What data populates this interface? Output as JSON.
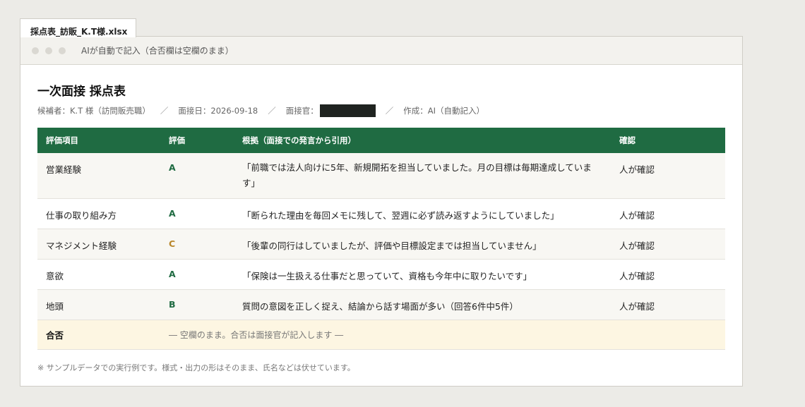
{
  "file_tab": {
    "label": "採点表_訪販_K.T様.xlsx"
  },
  "window": {
    "status_text": "AIが自動で記入（合否欄は空欄のまま）"
  },
  "document": {
    "title": "一次面接 採点表",
    "meta": {
      "candidate": "候補者：K.T 様（訪問販売職）",
      "date": "面接日：2026-09-18",
      "interviewer_label": "面接官：",
      "author": "作成：AI（自動記入）",
      "separator": "／"
    }
  },
  "table": {
    "headers": [
      "評価項目",
      "評価",
      "根拠（面接での発言から引用）",
      "確認"
    ],
    "rows": [
      {
        "item": "営業経験",
        "grade": "A",
        "evidence": "「前職では法人向けに5年、新規開拓を担当していました。月の目標は毎期達成していま す」",
        "confirm": "人が確認"
      },
      {
        "item": "仕事の取り組み方",
        "grade": "A",
        "evidence": "「断られた理由を毎回メモに残して、翌週に必ず読み返すようにしていました」",
        "confirm": "人が確認"
      },
      {
        "item": "マネジメント経験",
        "grade": "C",
        "evidence": "「後輩の同行はしていましたが、評価や目標設定までは担当していません」",
        "confirm": "人が確認"
      },
      {
        "item": "意欲",
        "grade": "A",
        "evidence": "「保険は一生扱える仕事だと思っていて、資格も今年中に取りたいです」",
        "confirm": "人が確認"
      },
      {
        "item": "地頭",
        "grade": "B",
        "evidence": "質問の意図を正しく捉え、結論から話す場面が多い（回答6件中5件）",
        "confirm": "人が確認"
      }
    ],
    "decision": {
      "label": "合否",
      "note": "― 空欄のまま。合否は面接官が記入します ―"
    }
  },
  "footnote": "※ サンプルデータでの実行例です。様式・出力の形はそのまま、氏名などは伏せています。",
  "colors": {
    "header_green": "#1f6b42",
    "grade_a": "#1f6b42",
    "grade_c": "#b8862a",
    "decision_row": "#fdf6e2"
  }
}
